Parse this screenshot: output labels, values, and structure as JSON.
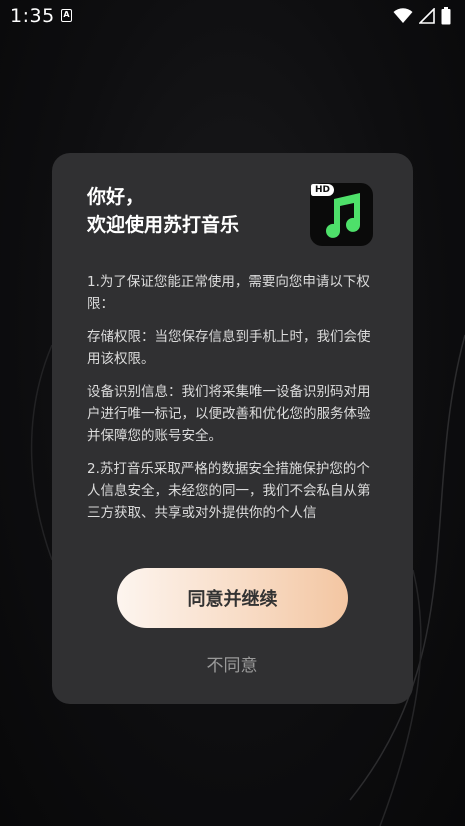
{
  "status_bar": {
    "time": "1:35",
    "app_icon_letter": "A",
    "icons": [
      "wifi-icon",
      "signal-icon",
      "battery-icon"
    ]
  },
  "dialog": {
    "greeting": "你好，",
    "welcome": "欢迎使用苏打音乐",
    "app_icon": {
      "badge": "HD",
      "glyph": "music-note-icon",
      "accent_color": "#4ee06a"
    },
    "paragraphs": [
      "1.为了保证您能正常使用，需要向您申请以下权限：",
      "存储权限：当您保存信息到手机上时，我们会使用该权限。",
      "设备识别信息：我们将采集唯一设备识别码对用户进行唯一标记，以便改善和优化您的服务体验并保障您的账号安全。",
      "2.苏打音乐采取严格的数据安全措施保护您的个人信息安全，未经您的同一，我们不会私自从第三方获取、共享或对外提供你的个人信"
    ],
    "agree_label": "同意并继续",
    "disagree_label": "不同意"
  },
  "colors": {
    "dialog_bg": "#303032",
    "agree_gradient_start": "#fdf5ef",
    "agree_gradient_end": "#f3c6a2",
    "disagree_text": "#9a9a9a"
  }
}
